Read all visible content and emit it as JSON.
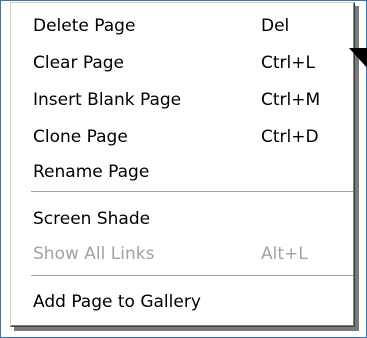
{
  "menu": {
    "items": [
      {
        "label": "Delete Page",
        "shortcut": "Del",
        "enabled": true
      },
      {
        "label": "Clear Page",
        "shortcut": "Ctrl+L",
        "enabled": true
      },
      {
        "label": "Insert Blank Page",
        "shortcut": "Ctrl+M",
        "enabled": true
      },
      {
        "label": "Clone Page",
        "shortcut": "Ctrl+D",
        "enabled": true
      },
      {
        "label": "Rename Page",
        "shortcut": "",
        "enabled": true
      },
      {
        "label": "Screen Shade",
        "shortcut": "",
        "enabled": true
      },
      {
        "label": "Show All Links",
        "shortcut": "Alt+L",
        "enabled": false
      },
      {
        "label": "Add Page to Gallery",
        "shortcut": "",
        "enabled": true
      }
    ]
  },
  "colors": {
    "text": "#000000",
    "disabled_text": "#a3a3a3",
    "frame": "#3b6fb6"
  },
  "icons": {
    "pointer": "arrow-pointer-icon"
  }
}
